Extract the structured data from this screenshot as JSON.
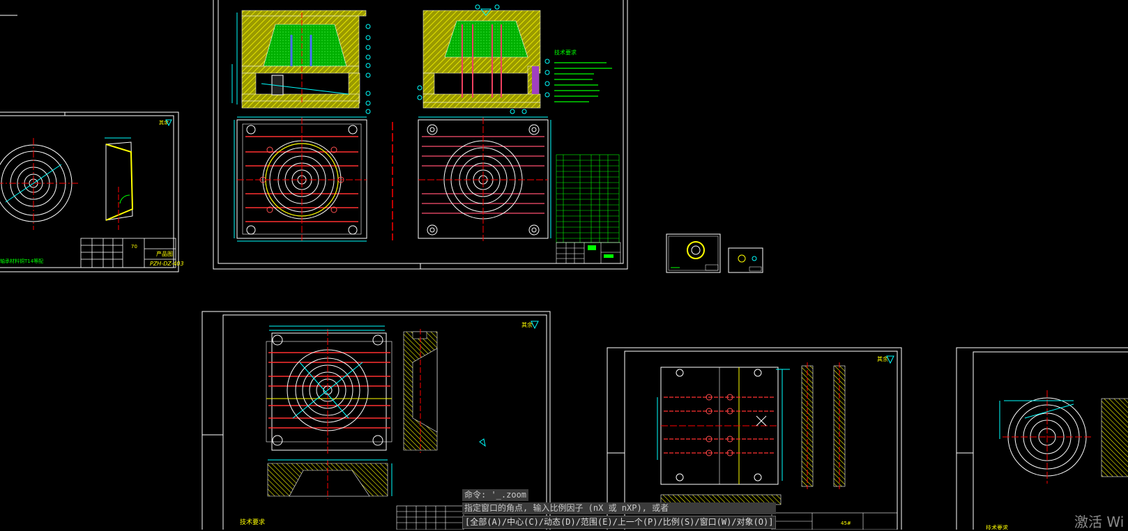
{
  "command_area": {
    "line1": "命令: '_.zoom",
    "line2": "指定窗口的角点, 输入比例因子 (nX 或 nXP), 或者",
    "line3": "[全部(A)/中心(C)/动态(D)/范围(E)/上一个(P)/比例(S)/窗口(W)/对象(O)]"
  },
  "watermark": "激活 Wi",
  "drawings": {
    "sheet_left": {
      "title_code": "PZH-DZ-403",
      "product_label": "产品图",
      "note": "轴承材料铜T14等配"
    },
    "sheet_main": {
      "tech_title": "技术要求"
    },
    "sheet_bottom": {
      "tech_title": "技术要求"
    },
    "sheet_right": {
      "tech_title": "技术要求"
    }
  },
  "colors": {
    "background": "#000000",
    "frame": "#ffffff",
    "outline": "#00ffff",
    "hatch": "#ffff00",
    "fill_yellow": "#b8b800",
    "fill_green": "#00c800",
    "center_line": "#ff0000",
    "text_green": "#00ff00",
    "pin_blue": "#4a6cff"
  }
}
